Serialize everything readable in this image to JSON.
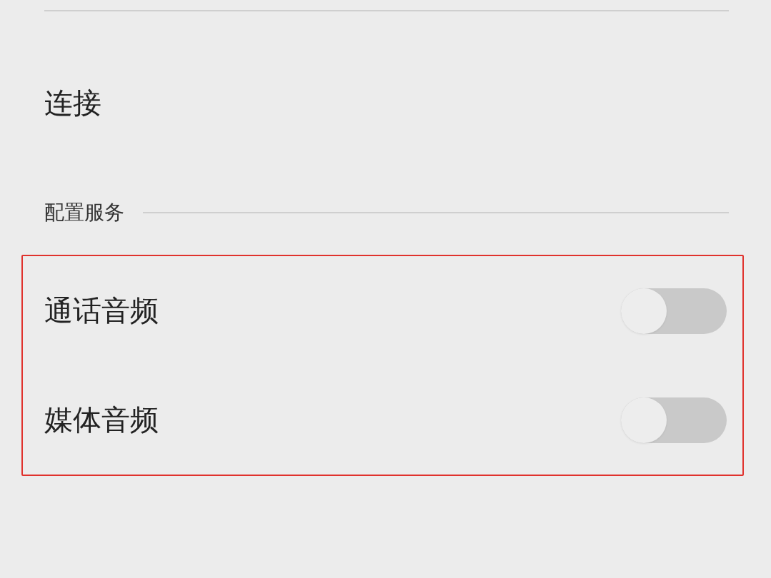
{
  "connection": {
    "title": "连接"
  },
  "services": {
    "title": "配置服务",
    "highlighted": true,
    "items": [
      {
        "label": "通话音频",
        "on": false
      },
      {
        "label": "媒体音频",
        "on": false
      }
    ]
  }
}
